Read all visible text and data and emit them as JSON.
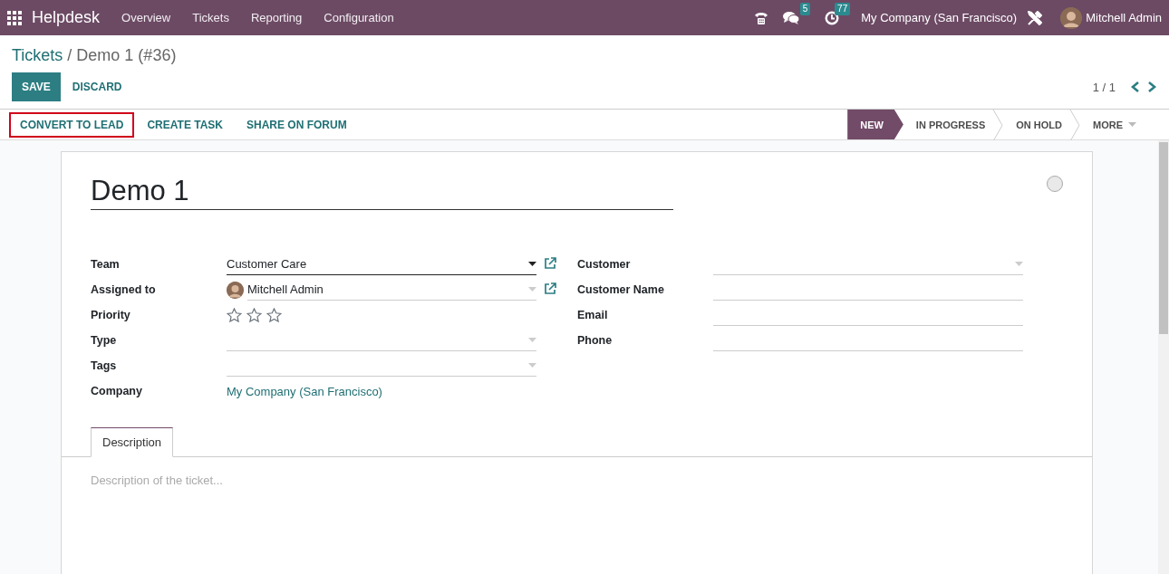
{
  "navbar": {
    "app": "Helpdesk",
    "menus": [
      "Overview",
      "Tickets",
      "Reporting",
      "Configuration"
    ],
    "messages_count": "5",
    "activities_count": "77",
    "company": "My Company (San Francisco)",
    "user": "Mitchell Admin"
  },
  "breadcrumb": {
    "parent": "Tickets",
    "current": "/ Demo 1 (#36)"
  },
  "buttons": {
    "save": "SAVE",
    "discard": "DISCARD"
  },
  "pager": {
    "value": "1 / 1"
  },
  "header_buttons": [
    {
      "label": "CONVERT TO LEAD",
      "highlighted": true
    },
    {
      "label": "CREATE TASK",
      "highlighted": false
    },
    {
      "label": "SHARE ON FORUM",
      "highlighted": false
    }
  ],
  "stages": [
    {
      "label": "NEW",
      "selected": true
    },
    {
      "label": "IN PROGRESS",
      "selected": false
    },
    {
      "label": "ON HOLD",
      "selected": false
    },
    {
      "label": "MORE",
      "selected": false,
      "kind": "dropdown"
    }
  ],
  "ticket": {
    "title": "Demo 1"
  },
  "left_fields": [
    {
      "label": "Team",
      "kind": "select",
      "value": "Customer Care",
      "focused": true,
      "external_link": true
    },
    {
      "label": "Assigned to",
      "kind": "user",
      "value": "Mitchell Admin",
      "focused": false,
      "external_link": true
    },
    {
      "label": "Priority",
      "kind": "stars",
      "stars": 0
    },
    {
      "label": "Type",
      "kind": "select",
      "focused": false,
      "external_link": false
    },
    {
      "label": "Tags",
      "kind": "select",
      "focused": false,
      "external_link": false
    },
    {
      "label": "Company",
      "kind": "link",
      "value": "My Company (San Francisco)"
    }
  ],
  "right_fields": [
    {
      "label": "Customer",
      "kind": "select",
      "focused": false
    },
    {
      "label": "Customer Name",
      "kind": "text"
    },
    {
      "label": "Email",
      "kind": "text"
    },
    {
      "label": "Phone",
      "kind": "text"
    }
  ],
  "notebook": {
    "tabs": [
      {
        "label": "Description",
        "selected": true
      }
    ],
    "placeholder": "Description of the ticket..."
  }
}
